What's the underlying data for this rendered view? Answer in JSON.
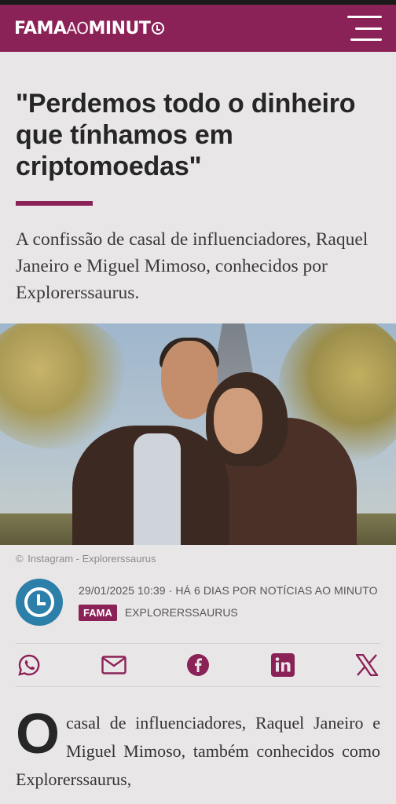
{
  "header": {
    "logo_part1": "FAMA",
    "logo_part2": "AO",
    "logo_part3": "MINUT",
    "brand_color": "#8b2257"
  },
  "article": {
    "headline": "\"Perdemos todo o dinheiro que tínhamos em criptomoedas\"",
    "lead": "A confissão de casal de influenciadores, Raquel Janeiro e Miguel Mimoso, conhecidos por Explorerssaurus.",
    "photo_caption_symbol": "©",
    "photo_caption": "Instagram - Explorerssaurus",
    "meta_line": "29/01/2025 10:39 · HÁ 6 DIAS POR NOTÍCIAS AO MINUTO",
    "section_badge": "FAMA",
    "tag": "EXPLORERSSAURUS",
    "dropcap": "O",
    "body": "casal de influenciadores, Raquel Janeiro e Miguel Mimoso, também conhecidos como Explorerssaurus,"
  },
  "share": {
    "icons": [
      "whatsapp-icon",
      "email-icon",
      "facebook-icon",
      "linkedin-icon",
      "x-icon"
    ],
    "icon_color": "#8b2257"
  }
}
